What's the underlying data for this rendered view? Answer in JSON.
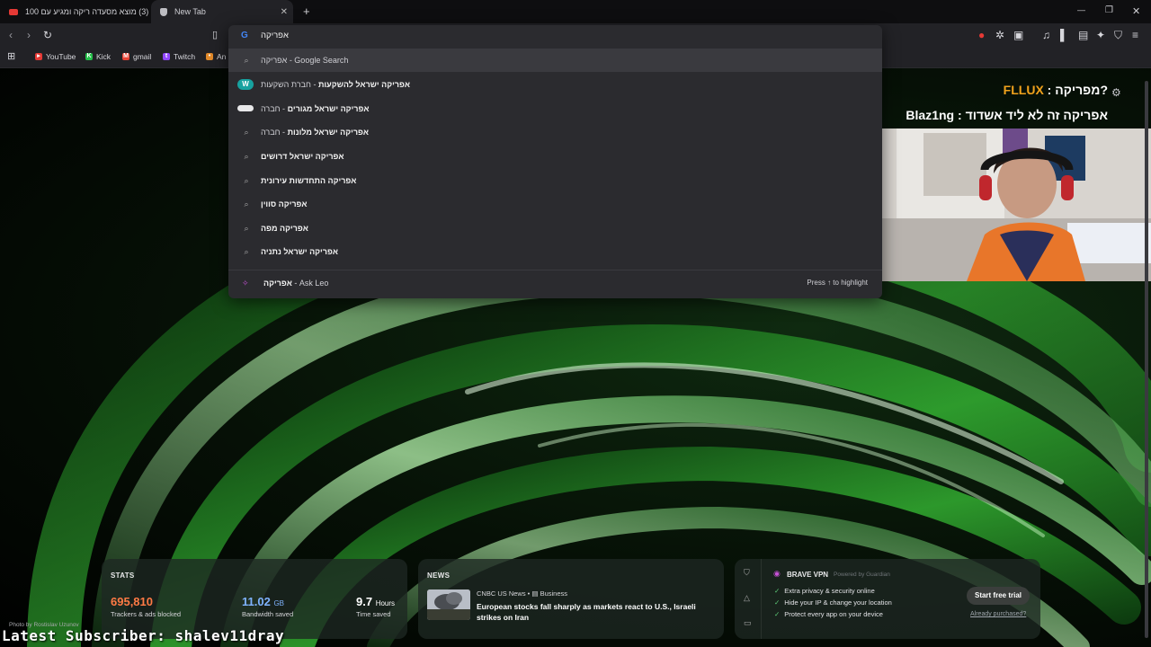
{
  "tabs": [
    {
      "title": "(3) מוצא מסעדה ריקה ומגיע עם 100",
      "active": false,
      "favicon": "youtube-icon"
    },
    {
      "title": "New Tab",
      "active": true,
      "favicon": "brave-shield-icon"
    }
  ],
  "new_tab_symbol": "+",
  "window_controls": {
    "minimize": "—",
    "restore": "❐",
    "close": "✕"
  },
  "omnibox": {
    "engine_icon": "G",
    "value": "אפריקה",
    "suggestions": [
      {
        "bold": "",
        "plain": "אפריקה - Google Search",
        "icon": "search-icon"
      },
      {
        "bold": "אפריקה ישראל להשקעות",
        "plain": " - חברת השקעות",
        "icon": "w-favicon"
      },
      {
        "bold": "אפריקה ישראל מגורים",
        "plain": " - חברה",
        "icon": "pill-favicon"
      },
      {
        "bold": "אפריקה ישראל מלונות",
        "plain": " - חברה",
        "icon": "search-icon"
      },
      {
        "bold": "אפריקה ישראל דרושים",
        "plain": "",
        "icon": "search-icon"
      },
      {
        "bold": "אפריקה התחדשות עירונית",
        "plain": "",
        "icon": "search-icon"
      },
      {
        "bold": "אפריקה סווין",
        "plain": "",
        "icon": "search-icon"
      },
      {
        "bold": "אפריקה מפה",
        "plain": "",
        "icon": "search-icon"
      },
      {
        "bold": "אפריקה ישראל נתניה",
        "plain": "",
        "icon": "search-icon"
      }
    ],
    "ask_leo": {
      "query": "אפריקה",
      "label": " - Ask Leo",
      "hint": "Press ↑ to highlight"
    }
  },
  "bookmarks": [
    {
      "label": "YouTube",
      "color": "#e53935",
      "icon": "youtube-icon"
    },
    {
      "label": "Kick",
      "color": "#25c04a",
      "icon": "kick-icon"
    },
    {
      "label": "gmail",
      "color": "#ea4335",
      "icon": "gmail-icon"
    },
    {
      "label": "Twitch",
      "color": "#9146ff",
      "icon": "twitch-icon"
    },
    {
      "label": "An",
      "color": "#e0892a",
      "icon": "bookmark-icon"
    }
  ],
  "chat_overlay": {
    "lines": [
      {
        "user": "FLLUX",
        "sep": " : ",
        "text": "מפריקה?"
      },
      {
        "user": "Blaz1ng",
        "sep": " : ",
        "text": "אפריקה זה לא ליד אשדוד"
      }
    ]
  },
  "stats": {
    "title": "STATS",
    "trackers": {
      "value": "695,810",
      "label": "Trackers & ads blocked",
      "color": "#ff7a45"
    },
    "bandwidth": {
      "value": "11.02",
      "unit": "GB",
      "label": "Bandwidth saved",
      "color": "#7fb3ff"
    },
    "time": {
      "value": "9.7",
      "unit": "Hours",
      "label": "Time saved",
      "color": "#ffffff"
    }
  },
  "news": {
    "title": "NEWS",
    "source": "CNBC US News",
    "category": "Business",
    "headline": "European stocks fall sharply as markets react to U.S., Israeli strikes on Iran"
  },
  "vpn": {
    "title": "BRAVE VPN",
    "powered": "Powered by  Guardian",
    "features": [
      "Extra privacy & security online",
      "Hide your IP & change your location",
      "Protect every app on your device"
    ],
    "cta": "Start free trial",
    "link": "Already purchased?"
  },
  "photo_credit": "Photo by Rostislav Uzunov",
  "subscriber_banner": "Latest Subscriber: shalev11dray"
}
